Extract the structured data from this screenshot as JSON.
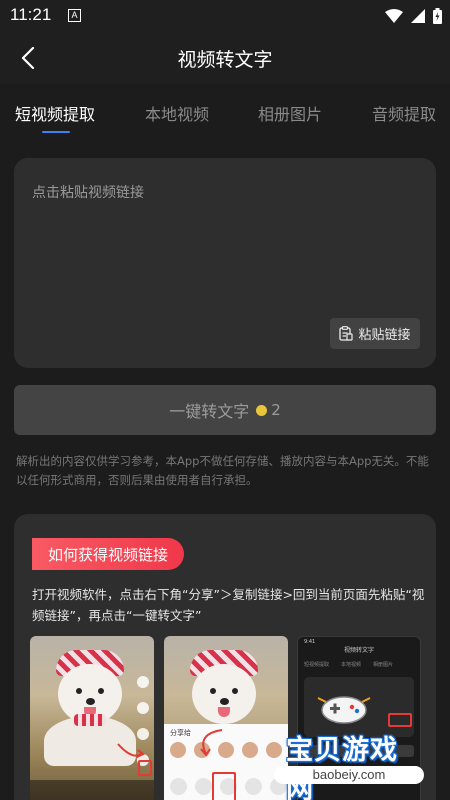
{
  "status_bar": {
    "time": "11:21",
    "badge": "A"
  },
  "header": {
    "title": "视频转文字"
  },
  "tabs": [
    {
      "label": "短视频提取",
      "active": true
    },
    {
      "label": "本地视频",
      "active": false
    },
    {
      "label": "相册图片",
      "active": false
    },
    {
      "label": "音频提取",
      "active": false
    }
  ],
  "input": {
    "placeholder": "点击粘贴视频链接",
    "paste_label": "粘贴链接"
  },
  "convert": {
    "label": "一键转文字",
    "cost": "2"
  },
  "disclaimer": "解析出的内容仅供学习参考，本App不做任何存储、播放内容与本App无关。不能以任何形式商用，否则后果由使用者自行承担。",
  "guide": {
    "badge": "如何获得视频链接",
    "text": "打开视频软件，点击右下角“分享”＞复制链接>回到当前页面先粘贴“视频链接”，再点击“一键转文字”",
    "share_sheet_title": "分享给",
    "mini_app_title": "视频转文字",
    "mini_time": "9:41",
    "mini_tabs": [
      "短视频提取",
      "本地视频",
      "相册图片"
    ]
  },
  "watermark": {
    "name": "宝贝游戏网",
    "domain": "baobeiy.com"
  },
  "colors": {
    "background": "#1c1c1c",
    "card": "#2e2e2e",
    "tab_indicator": "#3b82f6",
    "badge_red": "#f0384a",
    "coin": "#e8c53a"
  }
}
